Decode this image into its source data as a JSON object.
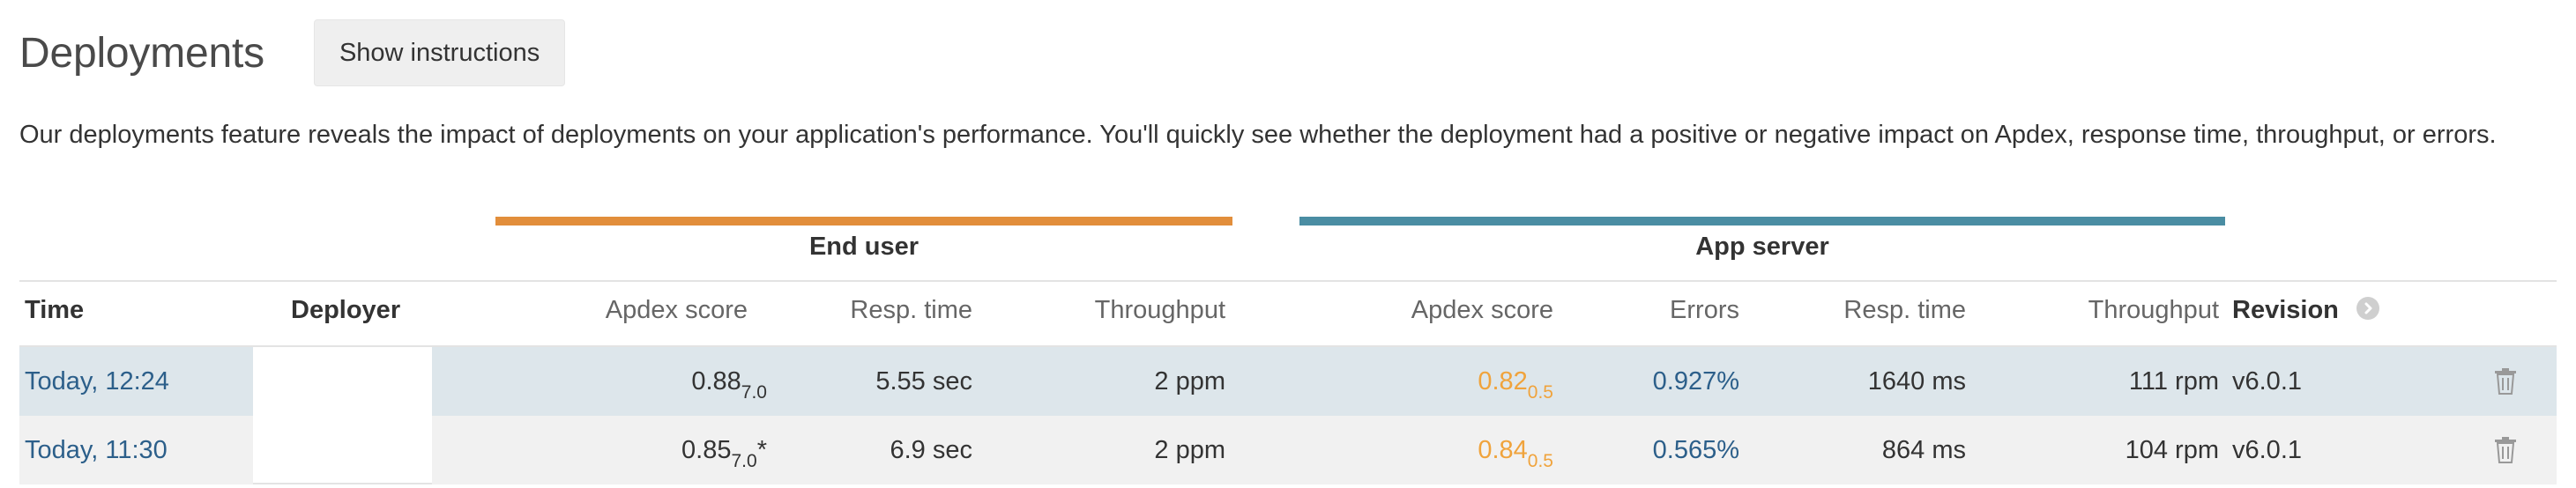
{
  "page": {
    "title": "Deployments",
    "instructions_button": "Show instructions",
    "description": "Our deployments feature reveals the impact of deployments on your application's performance. You'll quickly see whether the deployment had a positive or negative impact on Apdex, response time, throughput, or errors."
  },
  "groups": {
    "end_user": {
      "label": "End user",
      "color": "#e28e3b"
    },
    "app_server": {
      "label": "App server",
      "color": "#4a8da3"
    }
  },
  "columns": {
    "time": "Time",
    "deployer": "Deployer",
    "eu_apdex": "Apdex score",
    "eu_resp": "Resp. time",
    "eu_throughput": "Throughput",
    "as_apdex": "Apdex score",
    "as_errors": "Errors",
    "as_resp": "Resp. time",
    "as_throughput": "Throughput",
    "revision": "Revision",
    "revision_icon": "chevron-right-icon"
  },
  "rows": [
    {
      "time": "Today, 12:24",
      "deployer": "",
      "eu_apdex": "0.88",
      "eu_apdex_t": "7.0",
      "eu_apdex_flag": "",
      "eu_resp": "5.55 sec",
      "eu_throughput": "2 ppm",
      "as_apdex": "0.82",
      "as_apdex_t": "0.5",
      "as_errors": "0.927%",
      "as_resp": "1640 ms",
      "as_throughput": "111 rpm",
      "revision": "v6.0.1",
      "action_icon": "trash-icon"
    },
    {
      "time": "Today, 11:30",
      "deployer": "",
      "eu_apdex": "0.85",
      "eu_apdex_t": "7.0",
      "eu_apdex_flag": "*",
      "eu_resp": "6.9 sec",
      "eu_throughput": "2 ppm",
      "as_apdex": "0.84",
      "as_apdex_t": "0.5",
      "as_errors": "0.565%",
      "as_resp": "864 ms",
      "as_throughput": "104 rpm",
      "revision": "v6.0.1",
      "action_icon": "trash-icon"
    }
  ],
  "colors": {
    "row_highlight": "#dde6eb",
    "row_alt": "#f1f1f1",
    "link": "#2c5f8a",
    "apdex_orange": "#f0a33c"
  }
}
